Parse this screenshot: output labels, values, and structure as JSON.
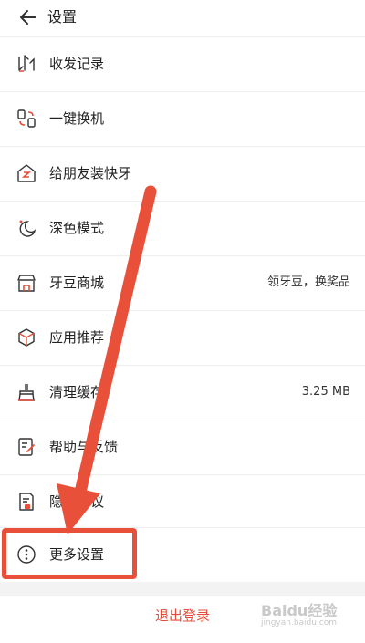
{
  "header": {
    "title": "设置",
    "back_icon": "arrow-left-icon"
  },
  "accent_color": "#e8503a",
  "items": [
    {
      "label": "收发记录",
      "icon": "send-receive-icon"
    },
    {
      "label": "一键换机",
      "icon": "phone-transfer-icon"
    },
    {
      "label": "给朋友装快牙",
      "icon": "share-app-icon"
    },
    {
      "label": "深色模式",
      "icon": "moon-icon"
    },
    {
      "label": "牙豆商城",
      "icon": "shop-icon",
      "value": "领牙豆，换奖品"
    },
    {
      "label": "应用推荐",
      "icon": "cube-icon"
    },
    {
      "label": "清理缓存",
      "icon": "broom-icon",
      "value": "3.25 MB"
    },
    {
      "label": "帮助与反馈",
      "icon": "feedback-edit-icon"
    },
    {
      "label": "隐私协议",
      "icon": "privacy-doc-icon"
    },
    {
      "label": "更多设置",
      "icon": "more-dots-icon"
    }
  ],
  "logout": {
    "label": "退出登录"
  },
  "watermark": {
    "main": "Baidu经验",
    "sub": "jingyan.baidu.com"
  }
}
